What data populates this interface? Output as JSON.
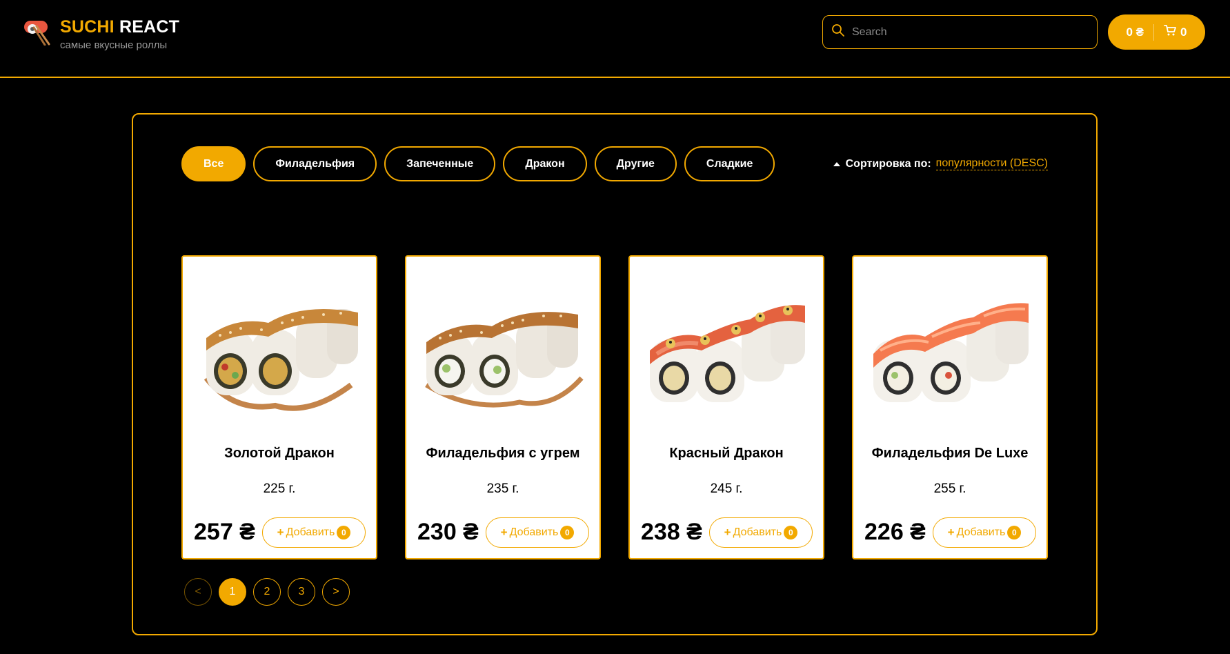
{
  "colors": {
    "accent": "#f2a900",
    "background": "#000000",
    "card": "#ffffff"
  },
  "header": {
    "brand_accent": "SUCHI",
    "brand_rest": "REACT",
    "tagline": "самые вкусные роллы",
    "logo_icon": "sushi-chopsticks-icon",
    "search": {
      "placeholder": "Search",
      "value": "",
      "icon": "search-icon"
    },
    "cart": {
      "total": "0 ₴",
      "count": "0",
      "icon": "cart-icon"
    }
  },
  "categories": [
    {
      "label": "Все",
      "active": true
    },
    {
      "label": "Филадельфия",
      "active": false
    },
    {
      "label": "Запеченные",
      "active": false
    },
    {
      "label": "Дракон",
      "active": false
    },
    {
      "label": "Другие",
      "active": false
    },
    {
      "label": "Сладкие",
      "active": false
    }
  ],
  "sort": {
    "label": "Сортировка по:",
    "value": "популярности (DESC)"
  },
  "products": [
    {
      "name": "Золотой Дракон",
      "weight": "225 г.",
      "price": "257 ₴",
      "add_label": "Добавить",
      "count": "0"
    },
    {
      "name": "Филадельфия с угрем",
      "weight": "235 г.",
      "price": "230 ₴",
      "add_label": "Добавить",
      "count": "0"
    },
    {
      "name": "Красный Дракон",
      "weight": "245 г.",
      "price": "238 ₴",
      "add_label": "Добавить",
      "count": "0"
    },
    {
      "name": "Филадельфия De Luxe",
      "weight": "255 г.",
      "price": "226 ₴",
      "add_label": "Добавить",
      "count": "0"
    }
  ],
  "pagination": {
    "prev": "<",
    "pages": [
      "1",
      "2",
      "3"
    ],
    "current": "1",
    "next": ">"
  }
}
